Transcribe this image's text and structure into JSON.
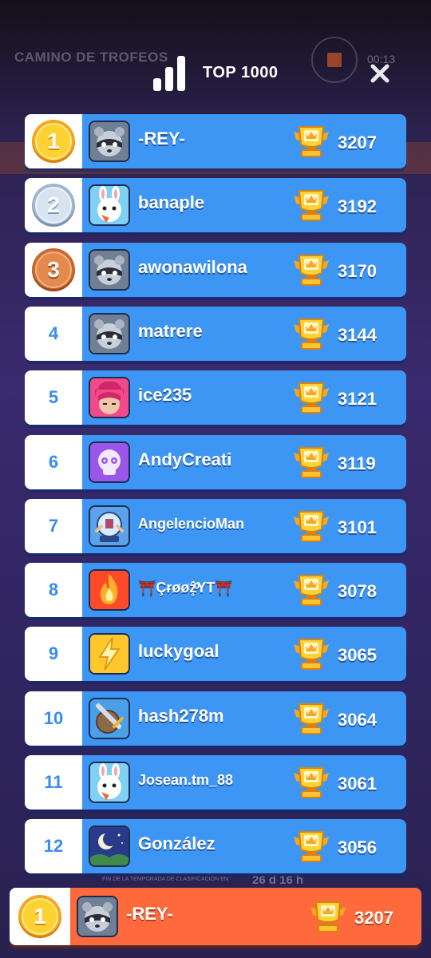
{
  "background": {
    "game_title": "CAMINO DE TROFEOS",
    "timer": "00:13",
    "season_label": "FIN DE LA TEMPORADA DE CLASIFICACIÓN EN:",
    "season_time": "26 d 16 h"
  },
  "header": {
    "title": "TOP 1000",
    "icon": "leaderboard-bars-icon",
    "close_icon": "close-icon"
  },
  "colors": {
    "row_blue": "#3d96f4",
    "highlight_orange": "#ff6a3d",
    "rank_text": "#3a8cec"
  },
  "rows": [
    {
      "rank": "1",
      "name": "-REY-",
      "score": "3207",
      "avatar": "raccoon-avatar",
      "medal": "gold"
    },
    {
      "rank": "2",
      "name": "banaple",
      "score": "3192",
      "avatar": "bunny-avatar",
      "medal": "silver"
    },
    {
      "rank": "3",
      "name": "awonawilona",
      "score": "3170",
      "avatar": "raccoon-avatar",
      "medal": "bronze"
    },
    {
      "rank": "4",
      "name": "matrere",
      "score": "3144",
      "avatar": "raccoon-avatar"
    },
    {
      "rank": "5",
      "name": "ice235",
      "score": "3121",
      "avatar": "pink-hair-avatar"
    },
    {
      "rank": "6",
      "name": "AndyCreati",
      "score": "3119",
      "avatar": "skull-avatar"
    },
    {
      "rank": "7",
      "name": "AngelencioMan",
      "score": "3101",
      "avatar": "snowglobe-avatar"
    },
    {
      "rank": "8",
      "name": "⛩️Çɍøøẑ̥ͦYT⛩️",
      "score": "3078",
      "avatar": "fire-avatar"
    },
    {
      "rank": "9",
      "name": "luckygoal",
      "score": "3065",
      "avatar": "lightning-avatar"
    },
    {
      "rank": "10",
      "name": "hash278m",
      "score": "3064",
      "avatar": "sword-shield-avatar"
    },
    {
      "rank": "11",
      "name": "Josean.tm_88",
      "score": "3061",
      "avatar": "bunny-avatar"
    },
    {
      "rank": "12",
      "name": "González",
      "score": "3056",
      "avatar": "moon-night-avatar"
    }
  ],
  "me": {
    "rank": "1",
    "name": "-REY-",
    "score": "3207",
    "avatar": "raccoon-avatar",
    "medal": "gold"
  }
}
